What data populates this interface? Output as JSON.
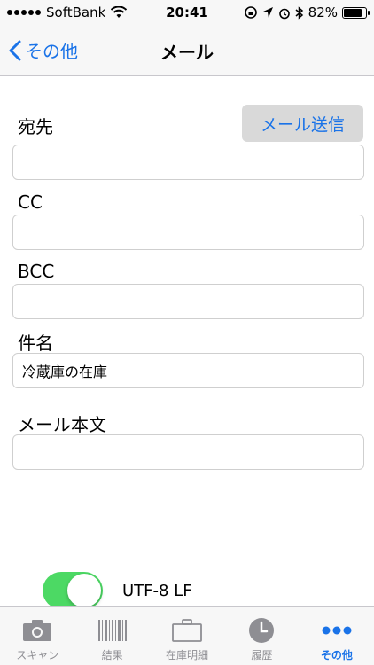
{
  "status": {
    "carrier": "SoftBank",
    "time": "20:41",
    "battery": "82%",
    "battery_level": 0.82
  },
  "nav": {
    "back_label": "その他",
    "title": "メール"
  },
  "form": {
    "to_label": "宛先",
    "send_label": "メール送信",
    "to_value": "",
    "cc_label": "CC",
    "cc_value": "",
    "bcc_label": "BCC",
    "bcc_value": "",
    "subject_label": "件名",
    "subject_value": "冷蔵庫の在庫",
    "body_label": "メール本文",
    "body_value": ""
  },
  "encoding": {
    "label": "UTF-8 LF",
    "enabled": true
  },
  "tabs": [
    {
      "label": "スキャン",
      "icon": "camera-icon"
    },
    {
      "label": "結果",
      "icon": "barcode-icon"
    },
    {
      "label": "在庫明細",
      "icon": "briefcase-icon"
    },
    {
      "label": "履歴",
      "icon": "clock-icon"
    },
    {
      "label": "その他",
      "icon": "more-icon",
      "active": true
    }
  ],
  "colors": {
    "accent": "#1a73e8",
    "toggle_on": "#4cd964",
    "tab_inactive": "#8e8e93"
  }
}
